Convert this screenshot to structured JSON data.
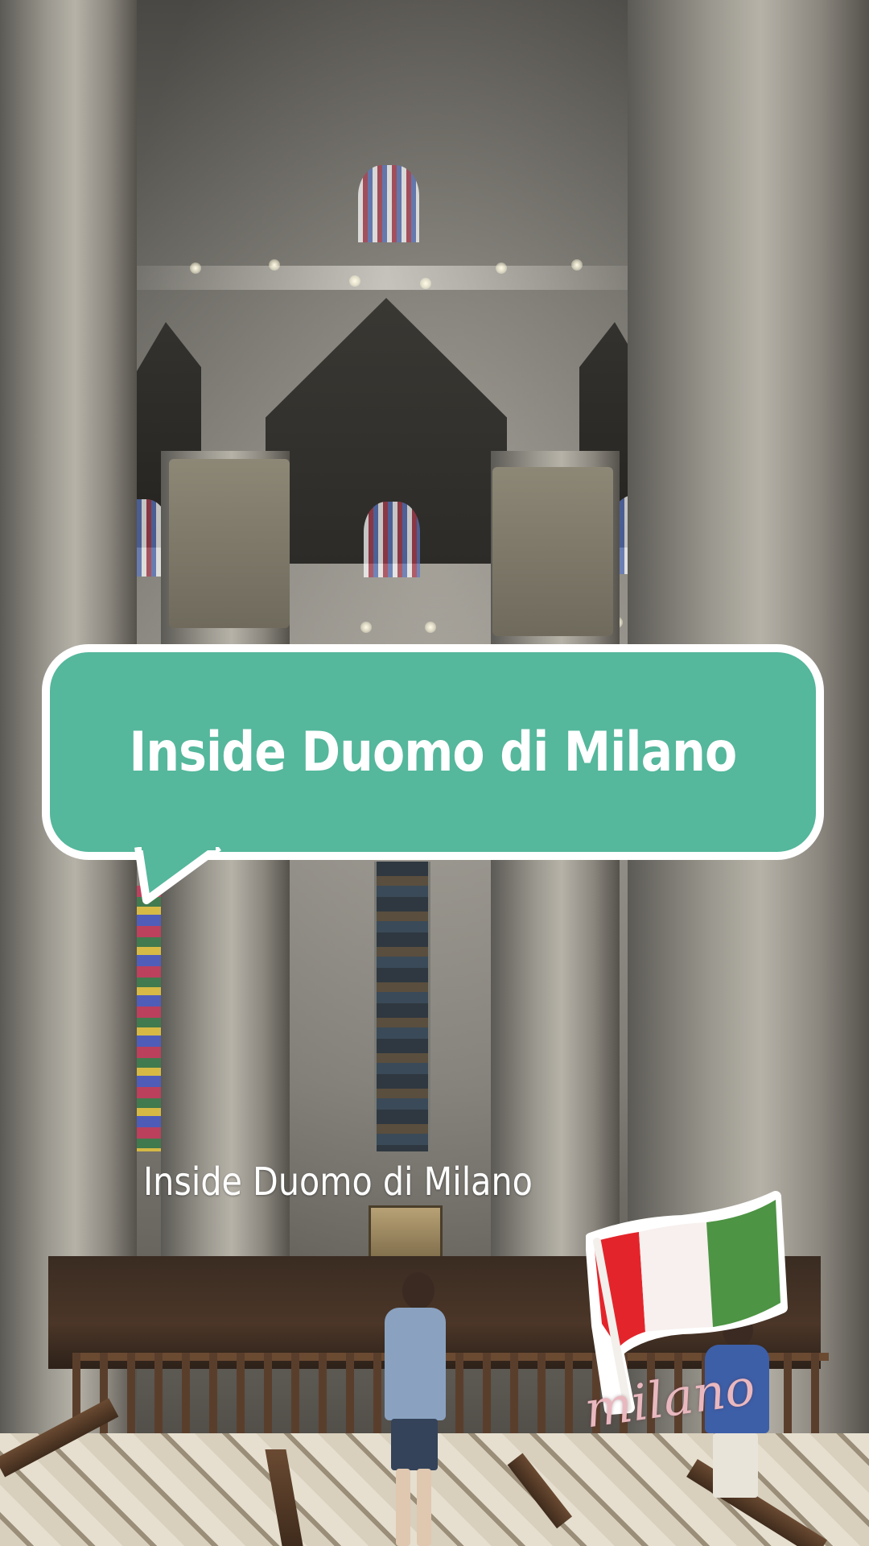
{
  "overlay": {
    "title_bubble_text": "Inside Duomo di Milano",
    "caption_text": "Inside Duomo di Milano",
    "sticker_text": "milano",
    "bubble_color": "#55b79c",
    "bubble_border_color": "#ffffff",
    "sticker_text_color": "#e9b8bf"
  },
  "flag": {
    "name": "italian-flag-sticker",
    "colors": [
      "#e3252b",
      "#f7f0ee",
      "#4d9444"
    ]
  },
  "background": {
    "description_icon": "cathedral-interior-photo"
  }
}
